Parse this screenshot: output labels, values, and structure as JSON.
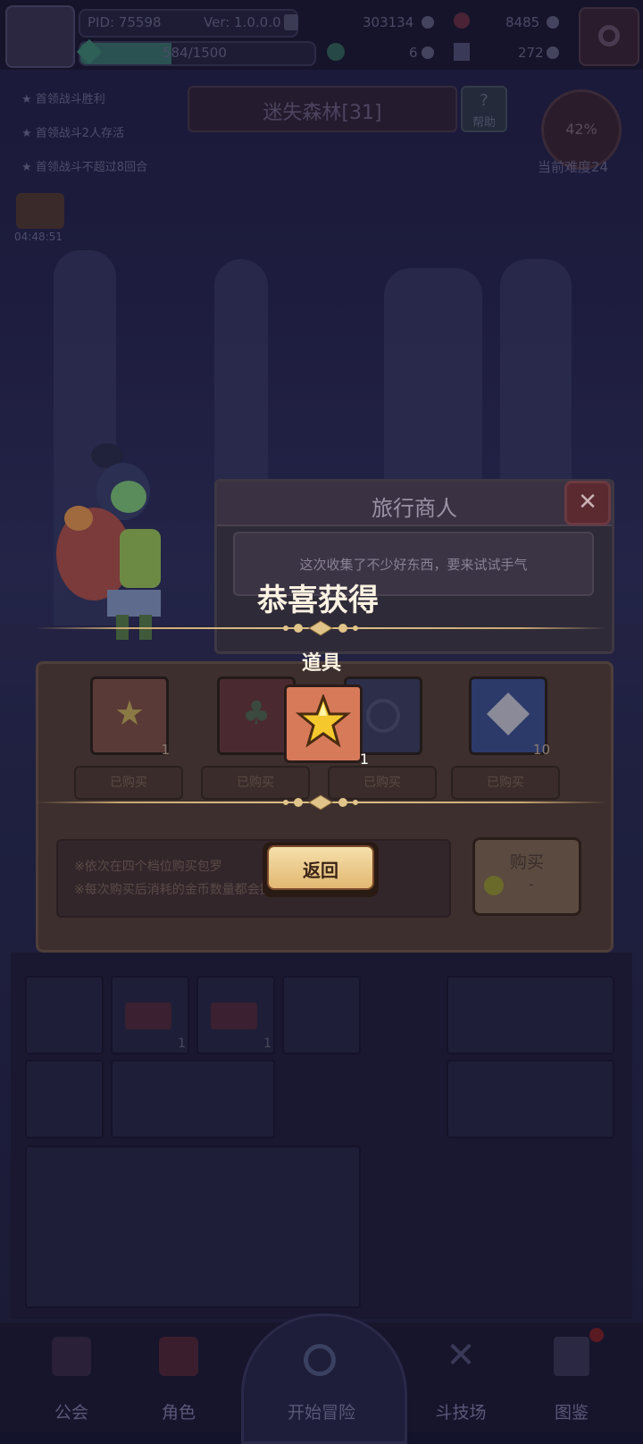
{
  "topbar": {
    "pid": "PID: 75598",
    "version": "Ver: 1.0.0.0",
    "exp": "584/1500",
    "exp_progress": 0.39,
    "gold": "303134",
    "gems": "8485",
    "clover": "6",
    "keys": "272"
  },
  "stage": {
    "title": "迷失森林[31]",
    "help_label": "帮助",
    "progress_percent": "42%",
    "difficulty": "当前难度24"
  },
  "quests": [
    "首领战斗胜利",
    "首领战斗2人存活",
    "首领战斗不超过8回合"
  ],
  "timer": "04:48:51",
  "merchant": {
    "title": "旅行商人",
    "dialog": "这次收集了不少好东西，要来试试手气"
  },
  "reward": {
    "title": "恭喜获得",
    "category": "道具",
    "item_count": "1",
    "back_label": "返回"
  },
  "shop": {
    "slots": [
      {
        "count": "1",
        "status": "已购买",
        "icon": "star-icon"
      },
      {
        "count": "",
        "status": "已购买",
        "icon": "clover-icon"
      },
      {
        "count": "",
        "status": "已购买",
        "icon": "ring-icon"
      },
      {
        "count": "10",
        "status": "已购买",
        "icon": "crystal-icon"
      }
    ],
    "notes": [
      "※依次在四个档位购买包罗",
      "※每次购买后消耗的金币数量都会提升"
    ],
    "buy_label": "购买",
    "buy_cost": "-"
  },
  "bottom_nav": [
    "公会",
    "角色",
    "开始冒险",
    "斗技场",
    "图鉴"
  ],
  "inventory_counts": [
    "1",
    "1"
  ],
  "colors": {
    "overlay": "#14132c",
    "gold_line": "#d8bb80",
    "reward_slot": "#d77a5a",
    "button_gold": "#e9c98a"
  }
}
